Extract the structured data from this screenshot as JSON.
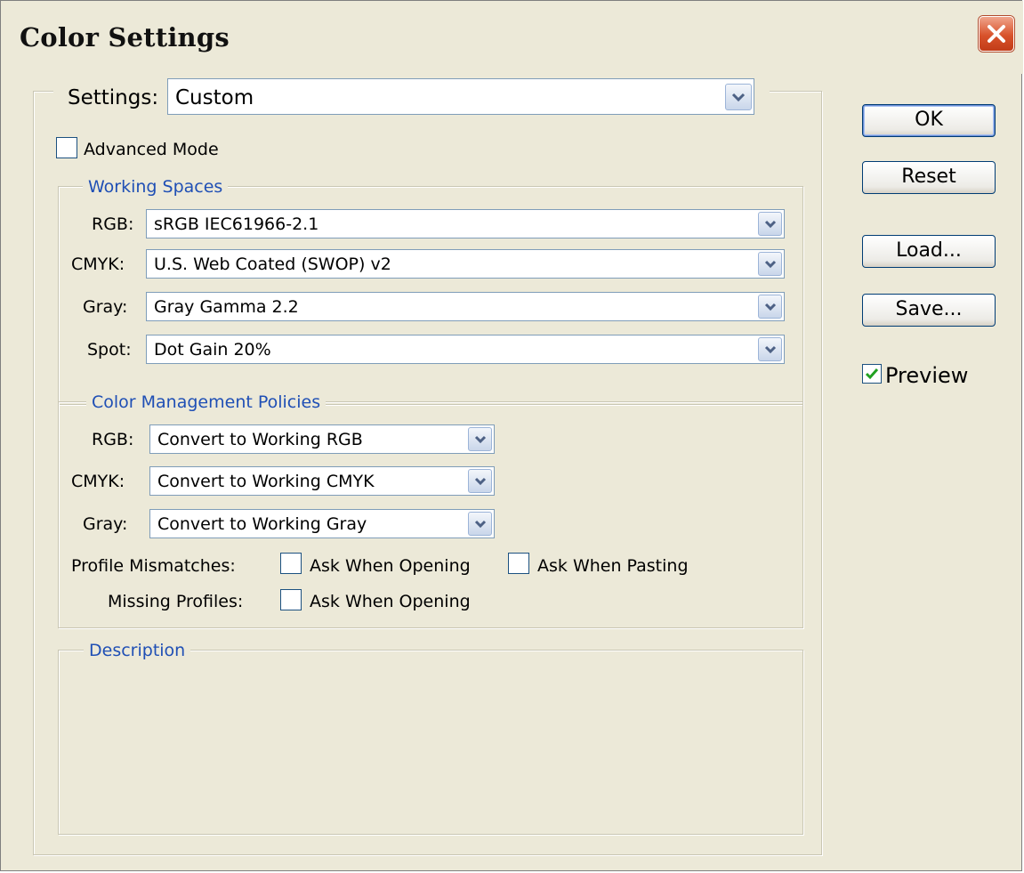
{
  "window": {
    "title": "Color Settings"
  },
  "settings": {
    "label": "Settings:",
    "value": "Custom"
  },
  "advanced_mode": {
    "label": "Advanced Mode",
    "checked": false
  },
  "working_spaces": {
    "legend": "Working Spaces",
    "rows": [
      {
        "label": "RGB:",
        "value": "sRGB IEC61966-2.1"
      },
      {
        "label": "CMYK:",
        "value": "U.S. Web Coated (SWOP) v2"
      },
      {
        "label": "Gray:",
        "value": "Gray Gamma 2.2"
      },
      {
        "label": "Spot:",
        "value": "Dot Gain 20%"
      }
    ]
  },
  "policies": {
    "legend": "Color Management Policies",
    "rows": [
      {
        "label": "RGB:",
        "value": "Convert to Working RGB"
      },
      {
        "label": "CMYK:",
        "value": "Convert to Working CMYK"
      },
      {
        "label": "Gray:",
        "value": "Convert to Working Gray"
      }
    ],
    "profile_mismatches": {
      "label": "Profile Mismatches:",
      "ask_opening": "Ask When Opening",
      "ask_pasting": "Ask When Pasting"
    },
    "missing_profiles": {
      "label": "Missing Profiles:",
      "ask_opening": "Ask When Opening"
    }
  },
  "description": {
    "legend": "Description"
  },
  "buttons": {
    "ok": "OK",
    "reset": "Reset",
    "load": "Load...",
    "save": "Save..."
  },
  "preview": {
    "label": "Preview",
    "checked": true
  },
  "colors": {
    "legend": "#1f4fb5",
    "face": "#ece9d8",
    "close": "#d8522b",
    "check": "#21a121"
  }
}
